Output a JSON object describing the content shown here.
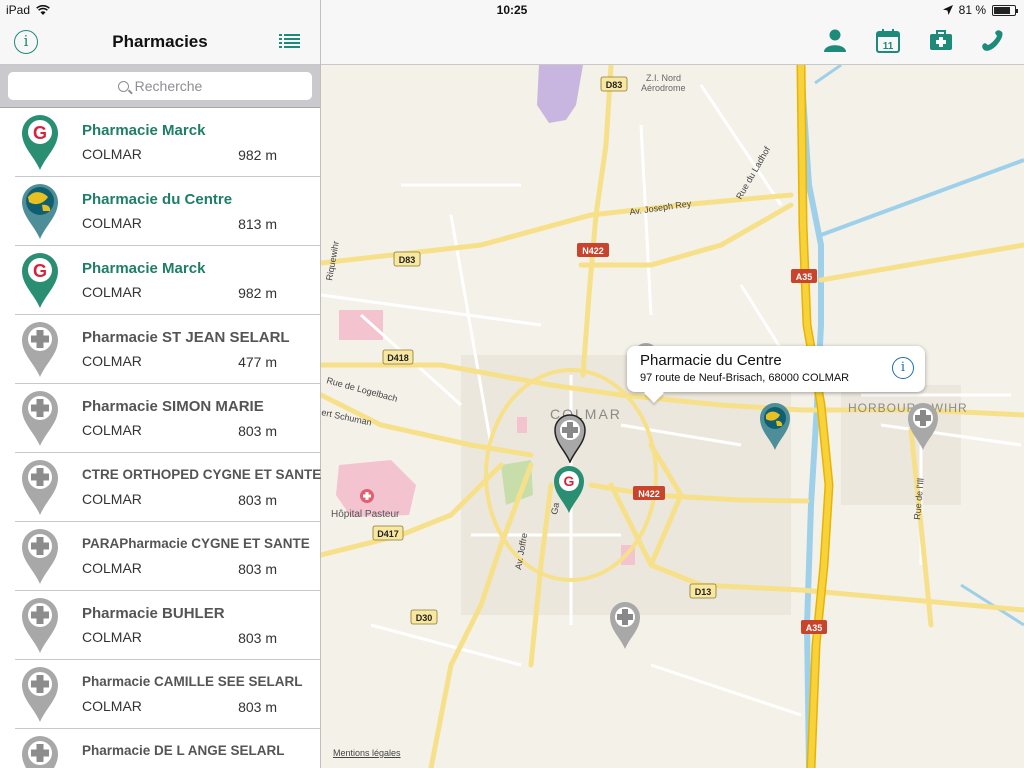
{
  "status": {
    "device": "iPad",
    "time": "10:25",
    "battery": "81 %",
    "battery_fraction": 0.81
  },
  "header": {
    "title": "Pharmacies"
  },
  "search": {
    "placeholder": "Recherche"
  },
  "pharmacies": [
    {
      "name": "Pharmacie Marck",
      "city": "COLMAR",
      "distance": "982 m",
      "icon": "giphar-green-pin"
    },
    {
      "name": "Pharmacie du Centre",
      "city": "COLMAR",
      "distance": "813 m",
      "icon": "globe-teal-pin"
    },
    {
      "name": "Pharmacie Marck",
      "city": "COLMAR",
      "distance": "982 m",
      "icon": "giphar-green-pin"
    },
    {
      "name": "Pharmacie ST JEAN SELARL",
      "city": "COLMAR",
      "distance": "477 m",
      "icon": "cross-grey-pin"
    },
    {
      "name": "Pharmacie SIMON MARIE",
      "city": "COLMAR",
      "distance": "803 m",
      "icon": "cross-grey-pin"
    },
    {
      "name": "CTRE ORTHOPED CYGNE ET SANTE",
      "city": "COLMAR",
      "distance": "803 m",
      "icon": "cross-grey-pin"
    },
    {
      "name": "PARAPharmacie CYGNE ET SANTE",
      "city": "COLMAR",
      "distance": "803 m",
      "icon": "cross-grey-pin"
    },
    {
      "name": "Pharmacie BUHLER",
      "city": "COLMAR",
      "distance": "803 m",
      "icon": "cross-grey-pin"
    },
    {
      "name": "Pharmacie CAMILLE SEE SELARL",
      "city": "COLMAR",
      "distance": "803 m",
      "icon": "cross-grey-pin"
    },
    {
      "name": "Pharmacie DE L ANGE SELARL",
      "city": "",
      "distance": "",
      "icon": "cross-grey-pin"
    }
  ],
  "toolbar": {
    "icons": [
      "person-icon",
      "calendar-icon",
      "first-aid-icon",
      "phone-icon"
    ],
    "calendar_day": "11"
  },
  "callout": {
    "title": "Pharmacie du Centre",
    "address": "97 route de Neuf-Brisach, 68000 COLMAR"
  },
  "map": {
    "place_labels": {
      "colmar": "COLMAR",
      "horbourg": "HORBOURG-WIHR",
      "zi1": "Z.I. Nord",
      "zi2": "Aérodrome",
      "hospital": "Hôpital Pasteur"
    },
    "roads": {
      "d83a": "D83",
      "d83b": "D83",
      "n422a": "N422",
      "n422b": "N422",
      "a35a": "A35",
      "a35b": "A35",
      "d418": "D418",
      "d417": "D417",
      "d13": "D13",
      "d30": "D30"
    },
    "streets": {
      "joseph_rey": "Av. Joseph Rey",
      "ladhof": "Rue du Ladhof",
      "logelbach": "Rue de Logelbach",
      "schuman": "ert Schuman",
      "joffre": "Av. Joffre",
      "ill": "Rue de l'Ill",
      "riquewihr": "Riquewihr",
      "ga": "Ga"
    },
    "legal": "Mentions légales"
  },
  "colors": {
    "accent": "#1e8a7a",
    "brand_green": "#1e7f66",
    "motorway": "#f5c518",
    "road": "#f7e08a"
  }
}
